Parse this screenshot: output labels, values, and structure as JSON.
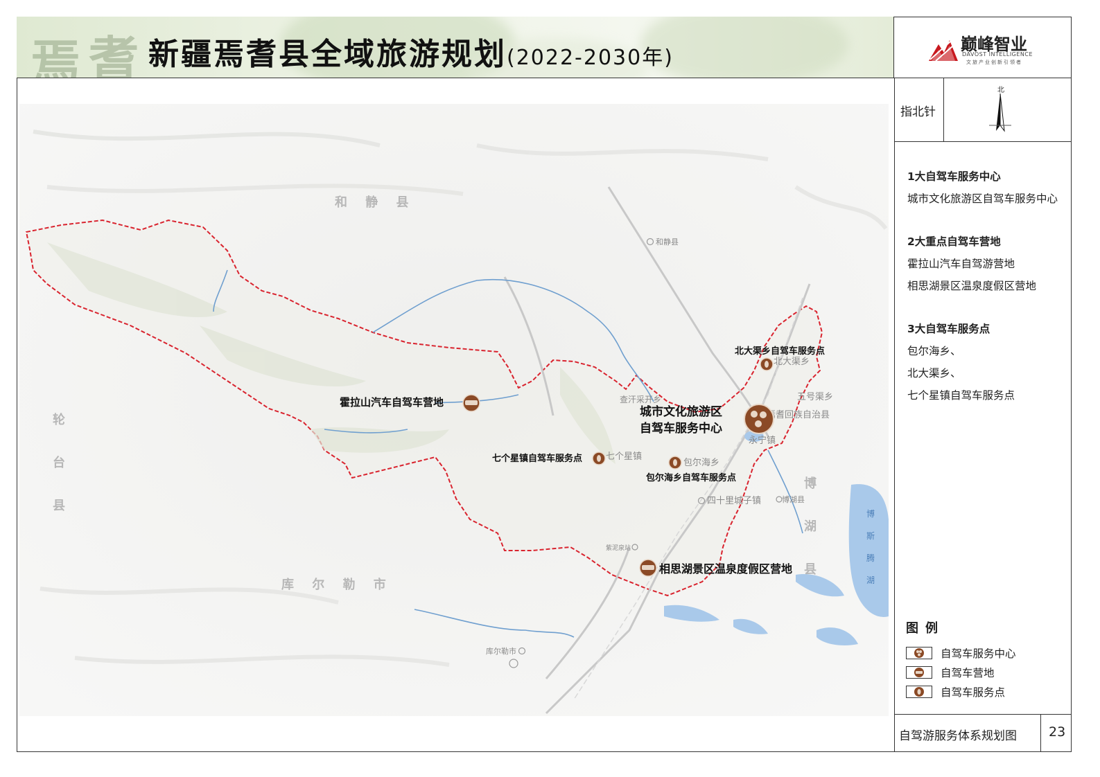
{
  "header": {
    "calligraphy": [
      "焉",
      "耆"
    ],
    "title": "新疆焉耆县全域旅游规划",
    "title_years": "(2022-2030年)"
  },
  "logo": {
    "name_cn": "巅峰智业",
    "name_en": "DAVOST INTELLIGENCE",
    "slogan": "文旅产业创新引领者"
  },
  "compass": {
    "label": "指北针",
    "north_char": "北"
  },
  "info": [
    {
      "heading": "1大自驾车服务中心",
      "lines": [
        "城市文化旅游区自驾车服务中心"
      ]
    },
    {
      "heading": "2大重点自驾车营地",
      "lines": [
        "霍拉山汽车自驾游营地",
        "相思湖景区温泉度假区营地"
      ]
    },
    {
      "heading": "3大自驾车服务点",
      "lines": [
        "包尔海乡、",
        "北大渠乡、",
        "七个星镇自驾车服务点"
      ]
    }
  ],
  "legend": {
    "title": "图例",
    "items": [
      {
        "icon": "service-center-icon",
        "label": "自驾车服务中心"
      },
      {
        "icon": "campsite-icon",
        "label": "自驾车营地"
      },
      {
        "icon": "service-point-icon",
        "label": "自驾车服务点"
      }
    ]
  },
  "footer": {
    "map_title": "自驾游服务体系规划图",
    "page_number": "23"
  },
  "map": {
    "regions": {
      "hejing": "和 静 县",
      "luntai_1": "轮",
      "luntai_2": "台",
      "luntai_3": "县",
      "korla": "库 尔 勒 市",
      "bohu_1": "博",
      "bohu_2": "湖",
      "bohu_3": "县"
    },
    "lake": [
      "博",
      "斯",
      "腾",
      "湖"
    ],
    "places": {
      "hejing_town": "和静县",
      "chahanquanqia": "查汗采开乡",
      "beidaqu": "北大渠乡",
      "wuhaoqu": "五号渠乡",
      "huizu": "焉耆回族自治县",
      "yongning": "永宁镇",
      "qigexing": "七个星镇",
      "baoerhai": "包尔海乡",
      "sishili": "四十里城子镇",
      "bohu_town": "博湖县",
      "ziniquan": "紫泥泉站",
      "korla_city": "库尔勒市"
    },
    "features": {
      "center": "城市文化旅游区自驾车服务中心",
      "center_line1": "城市文化旅游区",
      "center_line2": "自驾车服务中心",
      "horashan": "霍拉山汽车自驾车营地",
      "xiangsihu": "相思湖景区温泉度假区营地",
      "beidaqu_point": "北大渠乡自驾车服务点",
      "qigexing_point": "七个星镇自驾车服务点",
      "baoerhai_point": "包尔海乡自驾车服务点"
    },
    "colors": {
      "boundary": "#d9232e",
      "marker": "#8b4a26",
      "marker_inner": "#c07b48",
      "river": "#6f9fcf",
      "lake": "#a9c9ea"
    }
  }
}
